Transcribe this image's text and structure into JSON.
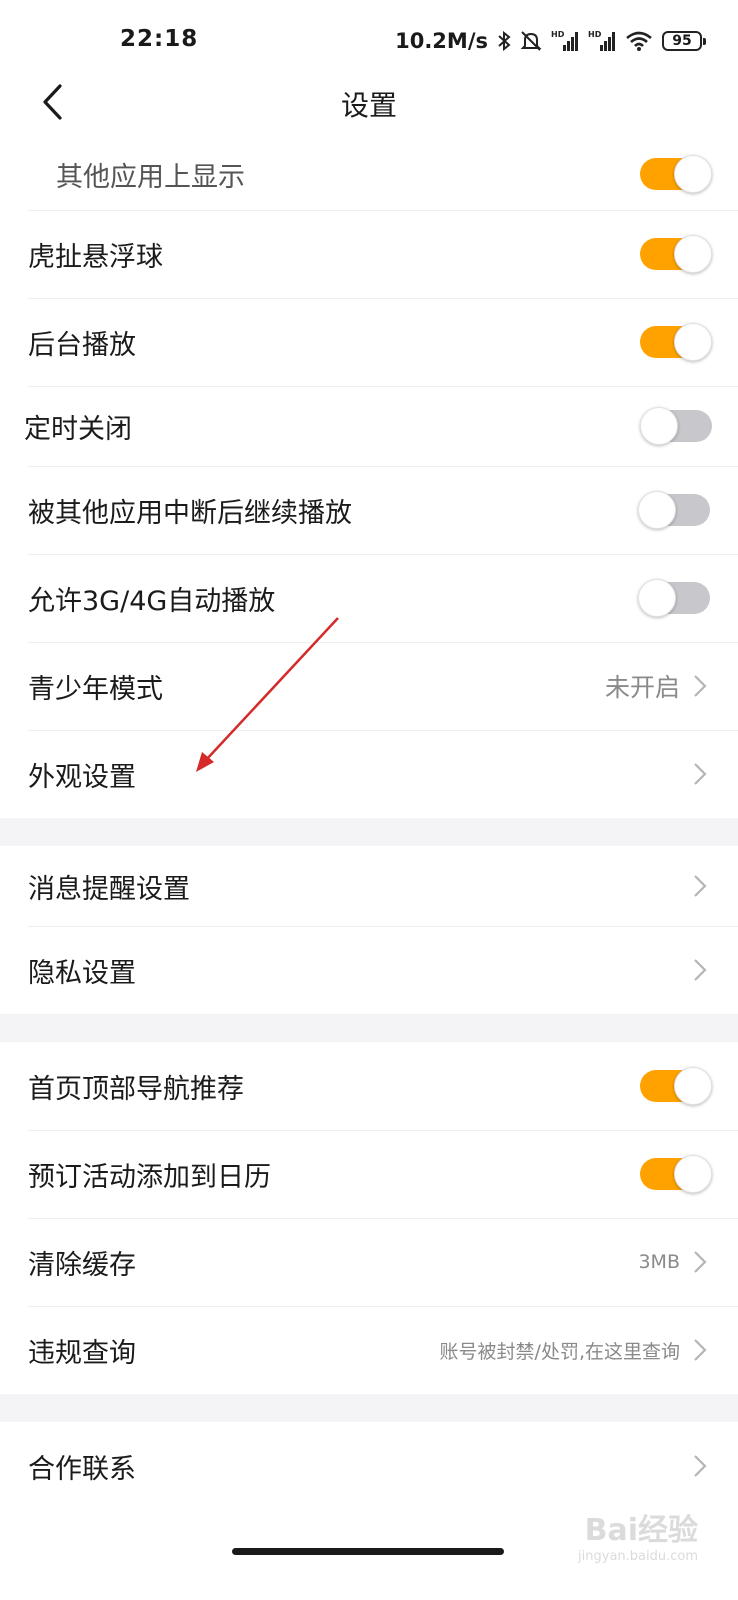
{
  "status_bar": {
    "time": "22:18",
    "net_speed": "10.2M/s",
    "battery": "95",
    "icons": [
      "bluetooth-icon",
      "mute-bell-icon",
      "hd-signal-icon",
      "hd-signal-icon",
      "wifi-icon",
      "battery-icon"
    ]
  },
  "header": {
    "title": "设置",
    "back_icon": "chevron-left-icon"
  },
  "section1": {
    "rows": [
      {
        "label": "其他应用上显示",
        "toggle": true
      },
      {
        "label": "虎扯悬浮球",
        "toggle": true
      },
      {
        "label": "后台播放",
        "toggle": true
      },
      {
        "label": "定时关闭",
        "toggle": false
      },
      {
        "label": "被其他应用中断后继续播放",
        "toggle": false
      },
      {
        "label": "允许3G/4G自动播放",
        "toggle": false
      },
      {
        "label": "青少年模式",
        "value": "未开启"
      },
      {
        "label": "外观设置"
      }
    ]
  },
  "section2": {
    "rows": [
      {
        "label": "消息提醒设置"
      },
      {
        "label": "隐私设置"
      }
    ]
  },
  "section3": {
    "rows": [
      {
        "label": "首页顶部导航推荐",
        "toggle": true
      },
      {
        "label": "预订活动添加到日历",
        "toggle": true
      },
      {
        "label": "清除缓存",
        "value": "3MB"
      },
      {
        "label": "违规查询",
        "value": "账号被封禁/处罚,在这里查询"
      }
    ]
  },
  "section4": {
    "rows": [
      {
        "label": "合作联系"
      }
    ]
  },
  "colors": {
    "toggle_on": "#ffa200",
    "toggle_off": "#c7c7cc",
    "annotation_arrow": "#d42a2a",
    "section_gap": "#f4f4f6"
  },
  "watermark": {
    "logo": "Bai经验",
    "url": "jingyan.baidu.com"
  }
}
